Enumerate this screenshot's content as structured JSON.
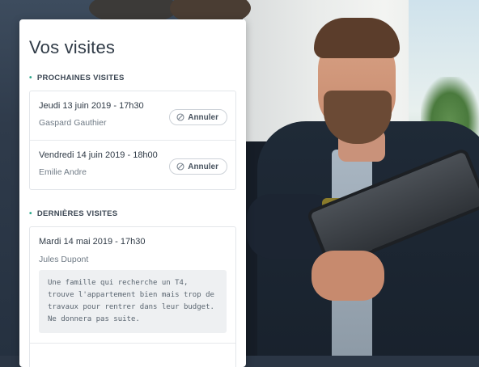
{
  "card": {
    "title": "Vos visites"
  },
  "upcoming": {
    "heading": "PROCHAINES VISITES",
    "visits": [
      {
        "date": "Jeudi 13 juin 2019 - 17h30",
        "name": "Gaspard Gauthier",
        "cancel_label": "Annuler"
      },
      {
        "date": "Vendredi 14 juin 2019 - 18h00",
        "name": "Emilie Andre",
        "cancel_label": "Annuler"
      }
    ]
  },
  "past": {
    "heading": "DERNIÈRES VISITES",
    "visits": [
      {
        "date": "Mardi 14 mai 2019 - 17h30",
        "name": "Jules Dupont",
        "note": "Une famille qui recherche un T4,\ntrouve l'appartement bien mais trop de\ntravaux pour rentrer dans leur budget.\nNe donnera pas suite."
      }
    ]
  },
  "icons": {
    "bullet": "dot-icon",
    "cancel": "ban-icon"
  },
  "colors": {
    "accent": "#2fa88b",
    "card_bg": "#ffffff",
    "text_dark": "#2f3a46",
    "text_muted": "#707b86",
    "note_bg": "#eef0f2"
  }
}
